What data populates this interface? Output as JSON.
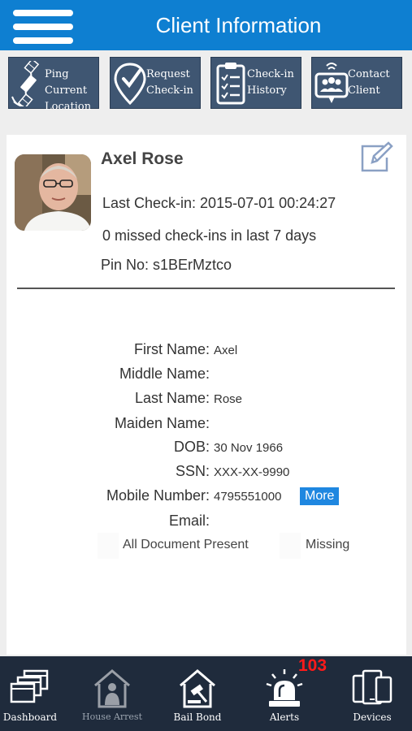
{
  "header": {
    "title": "Client Information"
  },
  "actions": [
    {
      "label": "Ping Current\nLocation",
      "icon": "satellite-icon"
    },
    {
      "label": "Request\nCheck-in",
      "icon": "location-check-icon"
    },
    {
      "label": "Check-in\nHistory",
      "icon": "clipboard-list-icon"
    },
    {
      "label": "Contact\nClient",
      "icon": "contact-group-icon"
    }
  ],
  "client": {
    "name": "Axel Rose",
    "last_checkin": "Last Check-in: 2015-07-01 00:24:27",
    "missed": "0 missed check-ins in last 7 days",
    "pin": "Pin No: s1BErMztco"
  },
  "details": [
    {
      "label": "First Name:",
      "value": "Axel"
    },
    {
      "label": "Middle Name:",
      "value": ""
    },
    {
      "label": "Last Name:",
      "value": "Rose"
    },
    {
      "label": "Maiden Name:",
      "value": ""
    },
    {
      "label": "DOB:",
      "value": "30 Nov 1966"
    },
    {
      "label": "SSN:",
      "value": "XXX-XX-9990"
    },
    {
      "label": "Mobile Number:",
      "value": "4795551000"
    },
    {
      "label": "Email:",
      "value": ""
    }
  ],
  "more_label": "More",
  "documents": {
    "present": "All Document Present",
    "missing": "Missing"
  },
  "tabs": [
    {
      "label": "Dashboard",
      "icon": "dashboard-icon"
    },
    {
      "label": "House Arrest",
      "icon": "house-arrest-icon"
    },
    {
      "label": "Bail Bond",
      "icon": "bail-bond-icon"
    },
    {
      "label": "Alerts",
      "icon": "alert-siren-icon"
    },
    {
      "label": "Devices",
      "icon": "devices-icon"
    }
  ],
  "alerts_badge": "103",
  "colors": {
    "header": "#0e7fd1",
    "action_tile": "#3f5672",
    "tabbar": "#1f2b3c",
    "badge": "#ff1a1a",
    "more_button": "#1f87e0"
  }
}
